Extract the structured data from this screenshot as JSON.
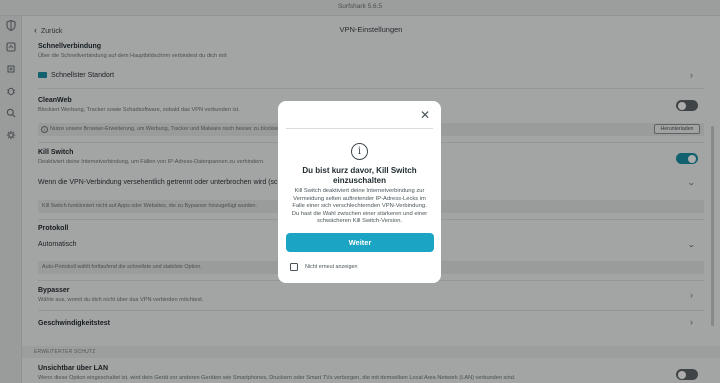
{
  "window": {
    "title": "Surfshark 5.6.5"
  },
  "sidebar": {
    "icons": [
      "shield-icon",
      "alert-icon",
      "cleanweb-icon",
      "bug-icon",
      "search-shield-icon",
      "gear-icon"
    ]
  },
  "topbar": {
    "back_label": "Zurück",
    "title": "VPN-Einstellungen"
  },
  "fastest_connection": {
    "title": "Schnellverbindung",
    "description": "Über die Schnellverbindung auf dem Hauptbildschirm verbindest du dich mit:",
    "option": "Schnellster Standort"
  },
  "cleanweb": {
    "title": "CleanWeb",
    "description": "Blockiert Werbung, Tracker sowie Schadsoftware, sobald das VPN verbunden ist.",
    "info": "Nutze unsere Browser-Erweiterung, um Werbung, Tracker und Malware noch besser zu blockieren.",
    "download_label": "Herunterladen",
    "enabled": false
  },
  "kill_switch": {
    "title": "Kill Switch",
    "description": "Deaktiviert deine Internetverbindung, um Fällen von IP-Adress-Datenpannen zu verhindern.",
    "dropdown": "Wenn die VPN-Verbindung versehentlich getrennt oder unterbrochen wird (schwacher Kill Switch)",
    "note": "Kill Switch funktioniert nicht auf Apps oder Websites, die zu Bypasser hinzugefügt wurden.",
    "enabled": true
  },
  "protocol": {
    "title": "Protokoll",
    "value": "Automatisch",
    "note": "Auto-Protokoll wählt fortlaufend die schnellste und stabilste Option."
  },
  "bypasser": {
    "title": "Bypasser",
    "description": "Wähle aus, womit du dich nicht über das VPN verbinden möchtest."
  },
  "speed_test": {
    "title": "Geschwindigkeitstest"
  },
  "advanced": {
    "section_label": "ERWEITERTER SCHUTZ",
    "lan_title": "Unsichtbar über LAN",
    "lan_description": "Wenn diese Option eingeschaltet ist, wird dein Gerät vor anderen Geräten wie Smartphones, Druckern oder Smart TVs verborgen, die mit demselben Local Area Network (LAN) verbunden sind.",
    "lan_enabled": false
  },
  "modal": {
    "title": "Du bist kurz davor, Kill Switch einzuschalten",
    "body": "Kill Switch deaktiviert deine Internetverbindung zur Vermeidung selten auftretender IP-Adress-Lecks im Falle einer sich verschlechternden VPN-Verbindung. Du hast die Wahl zwischen einer stärkeren und einer schwächeren Kill Switch-Version.",
    "button": "Weiter",
    "checkbox_label": "Nicht erneut anzeigen"
  },
  "colors": {
    "accent": "#1ba4c4",
    "toggle_on": "#1a8fa3"
  }
}
